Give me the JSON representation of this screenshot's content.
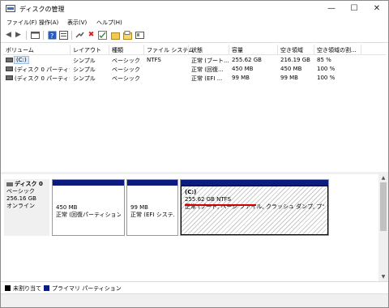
{
  "window": {
    "title": "ディスクの管理"
  },
  "window_controls": {
    "minimize": "—",
    "maximize": "☐",
    "close": "✕"
  },
  "menu": [
    "ファイル(F)",
    "操作(A)",
    "表示(V)",
    "ヘルプ(H)"
  ],
  "toolbar": [
    "back-icon",
    "forward-icon",
    "console-icon",
    "help-icon",
    "properties-icon",
    "connect-icon",
    "delete-icon",
    "check-icon",
    "new-folder-icon",
    "open-icon",
    "view-icon"
  ],
  "table": {
    "headers": [
      "ボリューム",
      "レイアウト",
      "種類",
      "ファイル システム",
      "状態",
      "容量",
      "空き領域",
      "空き領域の割..."
    ],
    "rows": [
      {
        "volume": "(C:)",
        "layout": "シンプル",
        "type": "ベーシック",
        "fs": "NTFS",
        "status": "正常 (ブート...",
        "capacity": "255.62 GB",
        "free": "216.19 GB",
        "pct": "85 %"
      },
      {
        "volume": "(ディスク 0 パーティシ...",
        "layout": "シンプル",
        "type": "ベーシック",
        "fs": "",
        "status": "正常 (回復...",
        "capacity": "450 MB",
        "free": "450 MB",
        "pct": "100 %"
      },
      {
        "volume": "(ディスク 0 パーティシ...",
        "layout": "シンプル",
        "type": "ベーシック",
        "fs": "",
        "status": "正常 (EFI ...",
        "capacity": "99 MB",
        "free": "99 MB",
        "pct": "100 %"
      }
    ]
  },
  "disk": {
    "name": "ディスク 0",
    "type": "ベーシック",
    "size": "256.16 GB",
    "state": "オンライン",
    "partitions": [
      {
        "size": "450 MB",
        "status": "正常 (回復パーティション)"
      },
      {
        "size": "99 MB",
        "status": "正常 (EFI システム"
      },
      {
        "name": "(C:)",
        "size": "255.62 GB NTFS",
        "status": "正常 (ブート, ページ ファイル, クラッシュ ダンプ, プライマリ パー"
      }
    ]
  },
  "legend": [
    {
      "label": "未割り当て",
      "color": "#000000"
    },
    {
      "label": "プライマリ パーティション",
      "color": "#0b1b80"
    }
  ],
  "colors": {
    "primary_partition": "#0b1b80",
    "selection": "#dbeaf8",
    "highlight_line": "#d40000"
  }
}
